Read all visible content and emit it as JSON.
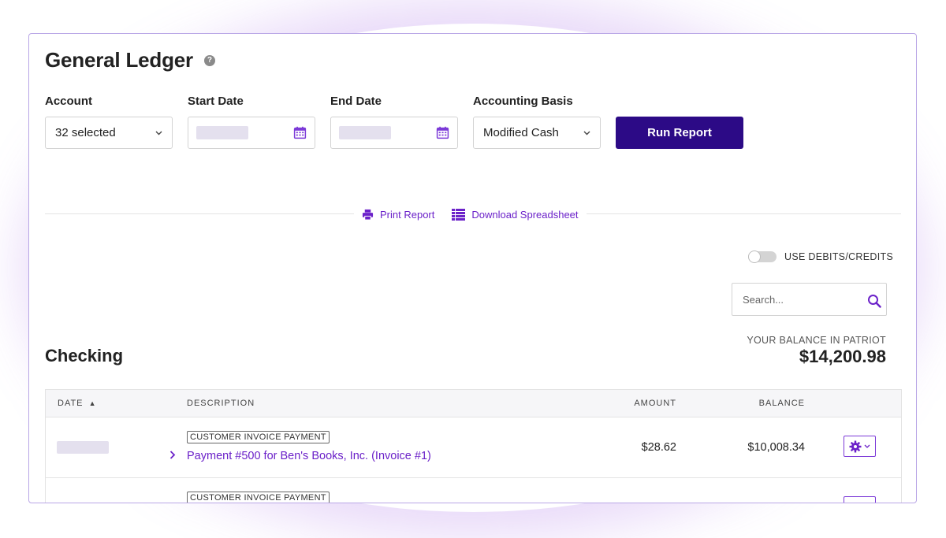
{
  "page": {
    "title": "General Ledger",
    "help_icon": "question-circle-icon",
    "help_glyph": "?"
  },
  "filters": {
    "account": {
      "label": "Account",
      "value": "32 selected"
    },
    "start_date": {
      "label": "Start Date",
      "value": ""
    },
    "end_date": {
      "label": "End Date",
      "value": ""
    },
    "accounting_basis": {
      "label": "Accounting Basis",
      "value": "Modified Cash"
    },
    "run_button": "Run Report"
  },
  "actions": {
    "print": {
      "label": "Print Report",
      "icon": "printer-icon"
    },
    "download": {
      "label": "Download Spreadsheet",
      "icon": "spreadsheet-icon"
    }
  },
  "toggle": {
    "label": "USE DEBITS/CREDITS",
    "on": false
  },
  "search": {
    "placeholder": "Search...",
    "icon": "search-icon"
  },
  "section": {
    "title": "Checking",
    "balance_label": "YOUR BALANCE IN PATRIOT",
    "balance_value": "$14,200.98"
  },
  "table": {
    "columns": {
      "date": "DATE",
      "sort_indicator": "▲",
      "description": "DESCRIPTION",
      "amount": "AMOUNT",
      "balance": "BALANCE"
    },
    "rows": [
      {
        "date": "",
        "type": "CUSTOMER INVOICE PAYMENT",
        "description": "Payment #500 for Ben's Books, Inc. (Invoice #1)",
        "amount": "$28.62",
        "balance": "$10,008.34"
      },
      {
        "date": "",
        "type": "CUSTOMER INVOICE PAYMENT",
        "description": "",
        "amount": "",
        "balance": ""
      }
    ]
  },
  "colors": {
    "accent": "#6b21c9",
    "primary_button": "#2c0a86",
    "card_border": "#b9a6e6",
    "glow": "#a86ee6"
  }
}
